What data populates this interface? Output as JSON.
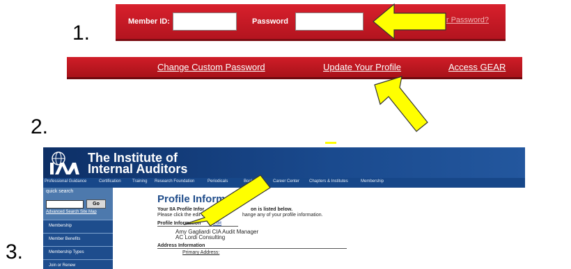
{
  "steps": [
    "1.",
    "2.",
    "3."
  ],
  "login_bar": {
    "member_id_label": "Member ID:",
    "password_label": "Password",
    "forgot_link": "r Password?"
  },
  "nav_bar": {
    "links": [
      "Change Custom Password",
      "Update Your Profile",
      "Access GEAR"
    ]
  },
  "iia": {
    "title_line1": "The Institute of",
    "title_line2": "Internal Auditors",
    "menu": [
      "Professional Guidance",
      "Certification",
      "Training",
      "Research Foundation",
      "Periodicals",
      "Bookstore",
      "Career Center",
      "Chapters & Institutes",
      "Membership"
    ],
    "sidebar": {
      "quick_search": "quick search",
      "go_button": "Go",
      "advanced_link": "Advanced Search  Site Map",
      "items": [
        "Membership",
        "Member Benefits",
        "Membership Types",
        "Join or Renew"
      ]
    },
    "content": {
      "heading": "Profile Informati",
      "intro_bold": "Your IIA Profile Infor",
      "intro_bold_end": "on is listed below.",
      "intro_text": "Please click the edit lin",
      "intro_text_end": "hange any of your profile information.",
      "profile_info_label": "Profile Information",
      "edit_link": "Edit",
      "profile_name": "Amy Gagliardi CIA Audit Manager",
      "profile_company": "AC Lordi Consulting",
      "address_label": "Address Information",
      "primary_address": "Primary Address:"
    }
  },
  "colors": {
    "login_red": "#c5161f",
    "iia_blue": "#1a4a8e",
    "arrow_yellow": "#ffff00"
  }
}
